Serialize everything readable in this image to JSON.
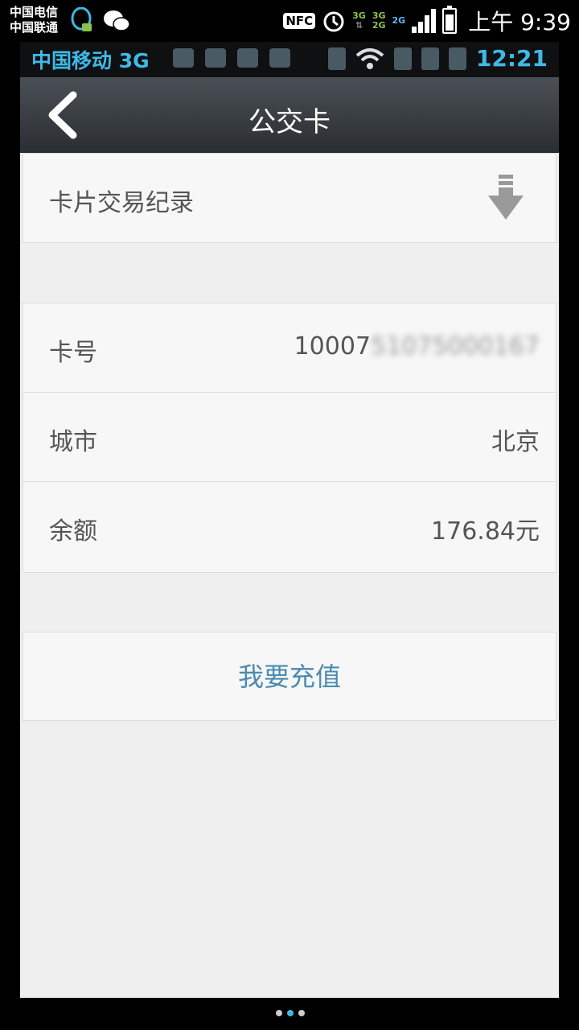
{
  "outer_status": {
    "carrier_1": "中国电信",
    "carrier_2": "中国联通",
    "nfc": "NFC",
    "net_1_top": "3G",
    "net_2_top": "3G",
    "net_2_bottom": "2G",
    "net_3_top": "2G",
    "time": "上午 9:39"
  },
  "inner_status": {
    "carrier": "中国移动 3G",
    "time": "12:21"
  },
  "header": {
    "title": "公交卡"
  },
  "record": {
    "label": "卡片交易纪录"
  },
  "info": {
    "card_no_label": "卡号",
    "card_no_prefix": "10007",
    "card_no_hidden": "51075000167",
    "city_label": "城市",
    "city_value": "北京",
    "balance_label": "余额",
    "balance_value": "176.84元"
  },
  "recharge": {
    "label": "我要充值"
  },
  "colors": {
    "accent": "#3fb9e6",
    "recharge_text": "#4b8bb0",
    "header_top": "#4a5055",
    "header_bottom": "#2a2e32"
  },
  "icons": [
    "qq-icon",
    "wechat-icon",
    "alarm-icon",
    "signal-icon",
    "battery-icon",
    "back-icon",
    "download-icon",
    "bluetooth-icon",
    "wifi-icon"
  ]
}
